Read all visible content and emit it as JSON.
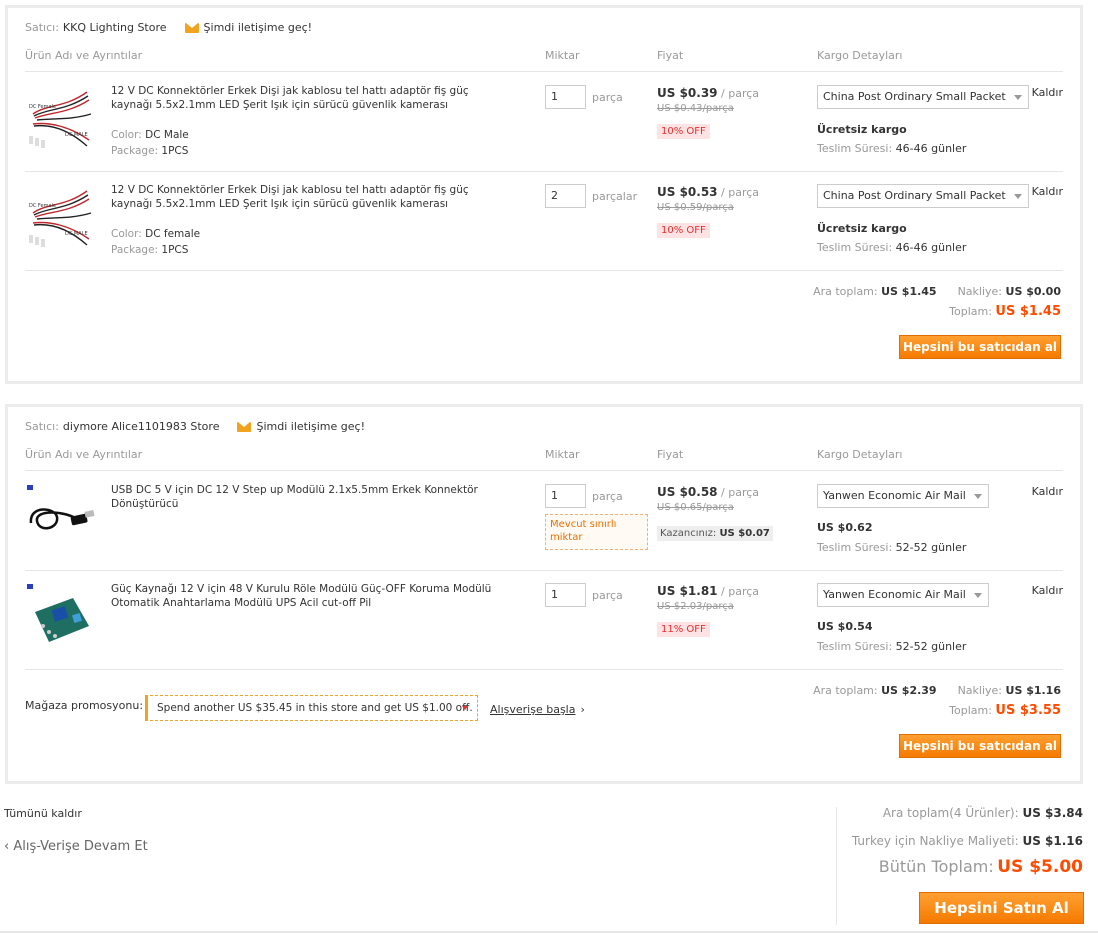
{
  "stores": [
    {
      "seller_label": "Satıcı:",
      "seller_name": "KKQ Lighting Store",
      "contact": "Şimdi iletişime geç!",
      "headers": {
        "product": "Ürün Adı ve Ayrıntılar",
        "qty": "Miktar",
        "price": "Fiyat",
        "shipping": "Kargo Detayları"
      },
      "items": [
        {
          "title": "12 V DC Konnektörler Erkek Dişi jak kablosu tel hattı adaptör fiş güç kaynağı 5.5x2.1mm LED Şerit Işık için sürücü güvenlik kamerası",
          "color_label": "Color:",
          "color": "DC Male",
          "package_label": "Package:",
          "package": "1PCS",
          "qty": "1",
          "unit": "parça",
          "price": "US $0.39",
          "per": "/ parça",
          "old_price": "US $0.43/parça",
          "discount": "10% OFF",
          "shipping_method": "China Post Ordinary Small Packet",
          "shipping_cost": "Ücretsiz kargo",
          "delivery_label": "Teslim Süresi:",
          "delivery": "46-46 günler",
          "remove": "Kaldır"
        },
        {
          "title": "12 V DC Konnektörler Erkek Dişi jak kablosu tel hattı adaptör fiş güç kaynağı 5.5x2.1mm LED Şerit Işık için sürücü güvenlik kamerası",
          "color_label": "Color:",
          "color": "DC female",
          "package_label": "Package:",
          "package": "1PCS",
          "qty": "2",
          "unit": "parçalar",
          "price": "US $0.53",
          "per": "/ parça",
          "old_price": "US $0.59/parça",
          "discount": "10% OFF",
          "shipping_method": "China Post Ordinary Small Packet",
          "shipping_cost": "Ücretsiz kargo",
          "delivery_label": "Teslim Süresi:",
          "delivery": "46-46 günler",
          "remove": "Kaldır"
        }
      ],
      "subtotal_label": "Ara toplam:",
      "subtotal": "US $1.45",
      "shipping_label": "Nakliye:",
      "shipping": "US $0.00",
      "total_label": "Toplam:",
      "total": "US $1.45",
      "buy_button": "Hepsini bu satıcıdan al"
    },
    {
      "seller_label": "Satıcı:",
      "seller_name": "diymore Alice1101983 Store",
      "contact": "Şimdi iletişime geç!",
      "headers": {
        "product": "Ürün Adı ve Ayrıntılar",
        "qty": "Miktar",
        "price": "Fiyat",
        "shipping": "Kargo Detayları"
      },
      "items": [
        {
          "title": "USB DC 5 V için DC 12 V Step up Modülü 2.1x5.5mm Erkek Konnektör Dönüştürücü",
          "qty": "1",
          "unit": "parça",
          "limited": "Mevcut sınırlı miktar",
          "price": "US $0.58",
          "per": "/ parça",
          "old_price": "US $0.65/parça",
          "save_label": "Kazancınız:",
          "save": "US $0.07",
          "shipping_method": "Yanwen Economic Air Mail",
          "shipping_cost": "US $0.62",
          "delivery_label": "Teslim Süresi:",
          "delivery": "52-52 günler",
          "remove": "Kaldır"
        },
        {
          "title": "Güç Kaynağı 12 V için 48 V Kurulu Röle Modülü Güç-OFF Koruma Modülü Otomatik Anahtarlama Modülü UPS Acil cut-off Pil",
          "qty": "1",
          "unit": "parça",
          "price": "US $1.81",
          "per": "/ parça",
          "old_price": "US $2.03/parça",
          "discount": "11% OFF",
          "shipping_method": "Yanwen Economic Air Mail",
          "shipping_cost": "US $0.54",
          "delivery_label": "Teslim Süresi:",
          "delivery": "52-52 günler",
          "remove": "Kaldır"
        }
      ],
      "promo_label": "Mağaza promosyonu:",
      "promo_text": "Spend another US $35.45 in this store and get US $1.00 off.",
      "shop_link": "Alışverişe başla",
      "subtotal_label": "Ara toplam:",
      "subtotal": "US $2.39",
      "shipping_label": "Nakliye:",
      "shipping": "US $1.16",
      "total_label": "Toplam:",
      "total": "US $3.55",
      "buy_button": "Hepsini bu satıcıdan al"
    }
  ],
  "footer": {
    "remove_all": "Tümünü kaldır",
    "continue": "‹ Alış-Verişe Devam Et",
    "subtotal_label": "Ara toplam(4 Ürünler):",
    "subtotal": "US $3.84",
    "shipping_label": "Turkey için Nakliye Maliyeti:",
    "shipping": "US $1.16",
    "grand_label": "Bütün Toplam:",
    "grand": "US $5.00",
    "buy_all": "Hepsini Satın Al"
  },
  "colors": {
    "accent": "#f57a00",
    "total": "#ff4c00",
    "discount_bg": "#fde3e3",
    "discount_fg": "#e62e2e"
  }
}
